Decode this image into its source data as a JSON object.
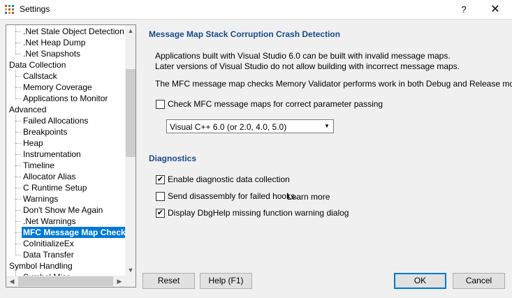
{
  "window": {
    "title": "Settings",
    "help_glyph": "?",
    "close_glyph": "✕"
  },
  "tree": {
    "items": [
      {
        "label": ".Net Stale Object Detection",
        "level": 1
      },
      {
        "label": ".Net Heap Dump",
        "level": 1
      },
      {
        "label": ".Net Snapshots",
        "level": 1
      },
      {
        "label": "Data Collection",
        "level": 0
      },
      {
        "label": "Callstack",
        "level": 1
      },
      {
        "label": "Memory Coverage",
        "level": 1
      },
      {
        "label": "Applications to Monitor",
        "level": 1
      },
      {
        "label": "Advanced",
        "level": 0
      },
      {
        "label": "Failed Allocations",
        "level": 1
      },
      {
        "label": "Breakpoints",
        "level": 1
      },
      {
        "label": "Heap",
        "level": 1
      },
      {
        "label": "Instrumentation",
        "level": 1
      },
      {
        "label": "Timeline",
        "level": 1
      },
      {
        "label": "Allocator Alias",
        "level": 1
      },
      {
        "label": "C Runtime Setup",
        "level": 1
      },
      {
        "label": "Warnings",
        "level": 1
      },
      {
        "label": "Don't Show Me Again",
        "level": 1
      },
      {
        "label": ".Net Warnings",
        "level": 1
      },
      {
        "label": "MFC Message Map Check",
        "level": 1,
        "selected": true
      },
      {
        "label": "CoInitializeEx",
        "level": 1
      },
      {
        "label": "Data Transfer",
        "level": 1
      },
      {
        "label": "Symbol Handling",
        "level": 0
      },
      {
        "label": "Symbol Misc",
        "level": 1
      }
    ]
  },
  "mfc": {
    "title": "Message Map Stack Corruption Crash Detection",
    "line1": "Applications built with Visual Studio 6.0 can be built with invalid message maps.",
    "line2": "Later versions of Visual Studio do not allow building with incorrect message maps.",
    "line3": "The MFC message map checks Memory Validator performs work in both Debug and Release modes.",
    "check_label": "Check MFC message maps for correct parameter passing",
    "check_checked": false,
    "combo_value": "Visual C++ 6.0 (or 2.0, 4.0, 5.0)"
  },
  "diagnostics": {
    "title": "Diagnostics",
    "options": [
      {
        "label": "Enable diagnostic data collection",
        "checked": true
      },
      {
        "label": "Send disassembly for failed hooks.",
        "checked": false
      },
      {
        "label": "Display DbgHelp missing function warning dialog",
        "checked": true
      }
    ],
    "learn_more": "Learn more"
  },
  "buttons": {
    "reset": "Reset",
    "help": "Help (F1)",
    "ok": "OK",
    "cancel": "Cancel"
  }
}
